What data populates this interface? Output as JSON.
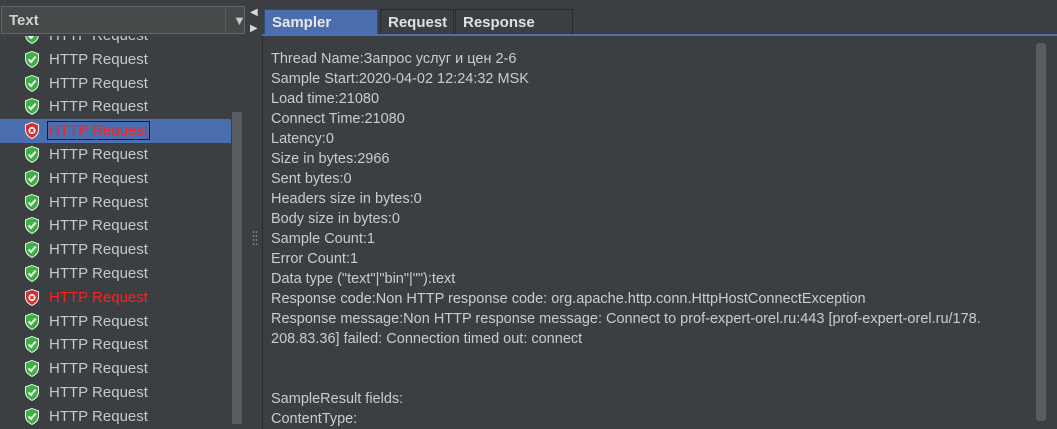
{
  "left_panel": {
    "renderer_select": {
      "value": "Text"
    },
    "tree_items": [
      {
        "label": "HTTP Request",
        "status": "success",
        "partial": true
      },
      {
        "label": "HTTP Request",
        "status": "success"
      },
      {
        "label": "HTTP Request",
        "status": "success"
      },
      {
        "label": "HTTP Request",
        "status": "success"
      },
      {
        "label": "HTTP Request",
        "status": "error",
        "selected": true
      },
      {
        "label": "HTTP Request",
        "status": "success"
      },
      {
        "label": "HTTP Request",
        "status": "success"
      },
      {
        "label": "HTTP Request",
        "status": "success"
      },
      {
        "label": "HTTP Request",
        "status": "success"
      },
      {
        "label": "HTTP Request",
        "status": "success"
      },
      {
        "label": "HTTP Request",
        "status": "success"
      },
      {
        "label": "HTTP Request",
        "status": "error"
      },
      {
        "label": "HTTP Request",
        "status": "success"
      },
      {
        "label": "HTTP Request",
        "status": "success"
      },
      {
        "label": "HTTP Request",
        "status": "success"
      },
      {
        "label": "HTTP Request",
        "status": "success"
      },
      {
        "label": "HTTP Request",
        "status": "success"
      }
    ]
  },
  "right_panel": {
    "tabs": [
      {
        "label": "Sampler result",
        "active": true
      },
      {
        "label": "Request",
        "active": false
      },
      {
        "label": "Response data",
        "active": false
      }
    ],
    "sampler_result_lines": [
      "Thread Name:Запрос услуг и цен 2-6",
      "Sample Start:2020-04-02 12:24:32 MSK",
      "Load time:21080",
      "Connect Time:21080",
      "Latency:0",
      "Size in bytes:2966",
      "Sent bytes:0",
      "Headers size in bytes:0",
      "Body size in bytes:0",
      "Sample Count:1",
      "Error Count:1",
      "Data type (\"text\"|\"bin\"|\"\"):text",
      "Response code:Non HTTP response code: org.apache.http.conn.HttpHostConnectException",
      "Response message:Non HTTP response message: Connect to prof-expert-orel.ru:443 [prof-expert-orel.ru/178.",
      "208.83.36] failed: Connection timed out: connect",
      "",
      "",
      "SampleResult fields:",
      "ContentType:"
    ]
  },
  "colors": {
    "background": "#3c3f41",
    "selection": "#4b6eaf",
    "error_text": "#ff1f1f",
    "success_icon": "#3cb043",
    "error_icon": "#d32f2f"
  },
  "icons": {
    "success": "green-shield-check-icon",
    "error": "red-shield-x-icon",
    "dropdown": "chevron-down-icon"
  }
}
